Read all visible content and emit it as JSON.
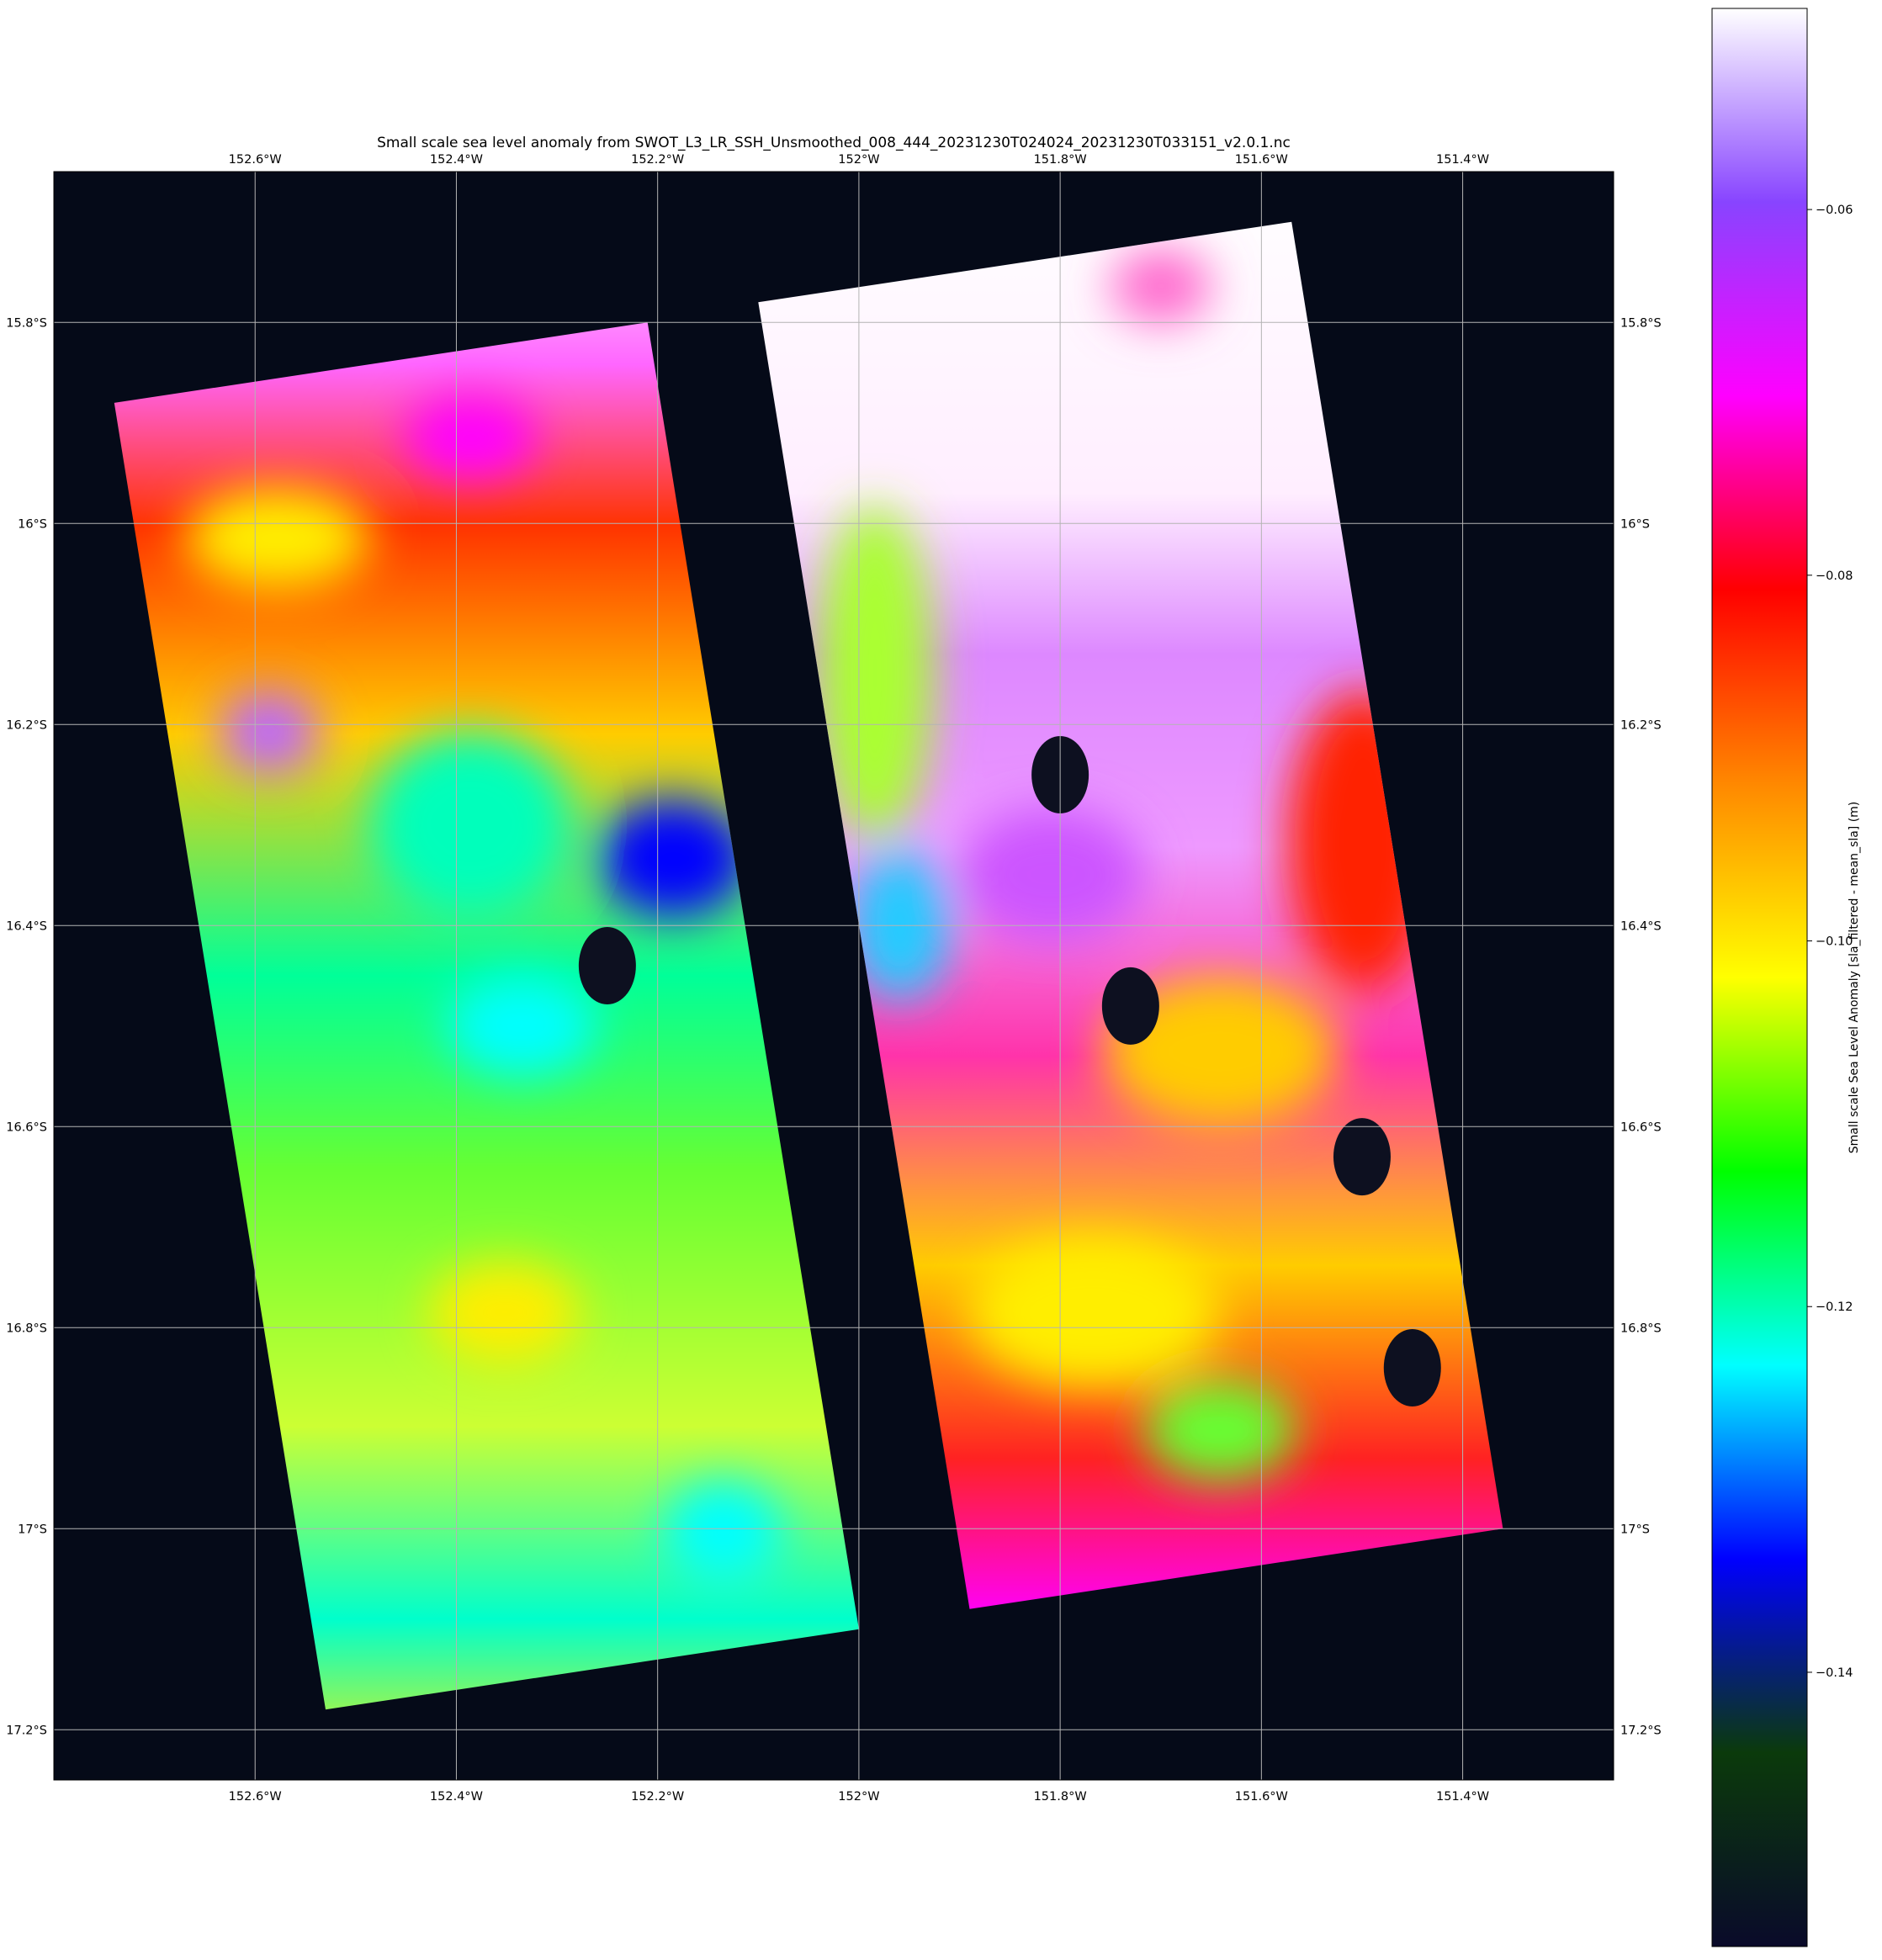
{
  "map": {
    "title": "Small scale sea level anomaly from SWOT_L3_LR_SSH_Unsmoothed_008_444_20231230T024024_20231230T033151_v2.0.1.nc",
    "lon_range": [
      -152.8,
      -151.25
    ],
    "lat_range": [
      -15.65,
      -17.25
    ],
    "lon_ticks": [
      {
        "value": -152.6,
        "label": "152.6°W"
      },
      {
        "value": -152.4,
        "label": "152.4°W"
      },
      {
        "value": -152.2,
        "label": "152.2°W"
      },
      {
        "value": -152.0,
        "label": "152°W"
      },
      {
        "value": -151.8,
        "label": "151.8°W"
      },
      {
        "value": -151.6,
        "label": "151.6°W"
      },
      {
        "value": -151.4,
        "label": "151.4°W"
      }
    ],
    "lat_ticks": [
      {
        "value": -15.8,
        "label": "15.8°S"
      },
      {
        "value": -16.0,
        "label": "16°S"
      },
      {
        "value": -16.2,
        "label": "16.2°S"
      },
      {
        "value": -16.4,
        "label": "16.4°S"
      },
      {
        "value": -16.6,
        "label": "16.6°S"
      },
      {
        "value": -16.8,
        "label": "16.8°S"
      },
      {
        "value": -17.0,
        "label": "17°S"
      },
      {
        "value": -17.2,
        "label": "17.2°S"
      }
    ],
    "background_color": "#050a18",
    "gridline_color": "#b4b4b4",
    "swaths": [
      {
        "name": "left",
        "corners": [
          [
            -152.74,
            -15.88
          ],
          [
            -152.21,
            -15.8
          ],
          [
            -152.0,
            -17.1
          ],
          [
            -152.53,
            -17.18
          ]
        ]
      },
      {
        "name": "right",
        "corners": [
          [
            -152.1,
            -15.78
          ],
          [
            -151.57,
            -15.7
          ],
          [
            -151.36,
            -17.0
          ],
          [
            -151.89,
            -17.08
          ]
        ]
      }
    ],
    "islands": [
      {
        "lon": -152.25,
        "lat": -16.44
      },
      {
        "lon": -151.8,
        "lat": -16.25
      },
      {
        "lon": -151.73,
        "lat": -16.48
      },
      {
        "lon": -151.5,
        "lat": -16.63
      },
      {
        "lon": -151.45,
        "lat": -16.84
      }
    ]
  },
  "colorbar": {
    "label": "Small scale Sea Level Anomaly [sla_filtered - mean_sla] (m)",
    "vmin": -0.155,
    "vmax": -0.049,
    "ticks": [
      {
        "value": -0.06,
        "label": "−0.06"
      },
      {
        "value": -0.08,
        "label": "−0.08"
      },
      {
        "value": -0.1,
        "label": "−0.10"
      },
      {
        "value": -0.12,
        "label": "−0.12"
      },
      {
        "value": -0.14,
        "label": "−0.14"
      }
    ],
    "colormap_stops": [
      "#0a0a2a",
      "#0b3a0b",
      "#0000ff",
      "#00ffff",
      "#00ff00",
      "#ffff00",
      "#ff8800",
      "#ff0000",
      "#ff00ff",
      "#8844ff",
      "#ffffff"
    ]
  }
}
